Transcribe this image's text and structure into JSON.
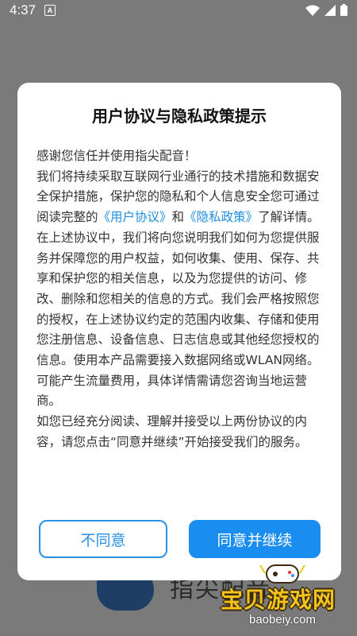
{
  "status_bar": {
    "time": "4:37",
    "notification_letter": "A"
  },
  "background": {
    "app_name": "指尖配音"
  },
  "dialog": {
    "title": "用户协议与隐私政策提示",
    "paragraphs": {
      "p1": "感谢您信任并使用指尖配音！",
      "p2_before": "我们将持续采取互联网行业通行的技术措施和数据安全保护措施，保护您的隐私和个人信息安全您可通过阅读完整的",
      "link_user_agreement": "《用户协议》",
      "p2_and": "和",
      "link_privacy_policy": "《隐私政策》",
      "p2_after": "了解详情。",
      "p3": "在上述协议中，我们将向您说明我们如何为您提供服务并保障您的用户权益，如何收集、使用、保存、共享和保护您的相关信息，以及为您提供的访问、修改、删除和您相关的信息的方式。我们会严格按照您的授权，在上述协议约定的范围内收集、存储和使用您注册信息、设备信息、日志信息或其他经您授权的信息。使用本产品需要接入数据网络或WLAN网络。可能产生流量费用，具体详情需请您咨询当地运营商。",
      "p4": "如您已经充分阅读、理解并接受以上两份协议的内容，请您点击“同意并继续”开始接受我们的服务。"
    },
    "buttons": {
      "disagree": "不同意",
      "agree": "同意并继续"
    }
  },
  "watermark": {
    "text": "宝贝游戏网",
    "url": "baobeiy.com"
  },
  "colors": {
    "accent": "#1a8df0",
    "link": "#1f8fe0",
    "overlay": "#7a7a7a"
  }
}
